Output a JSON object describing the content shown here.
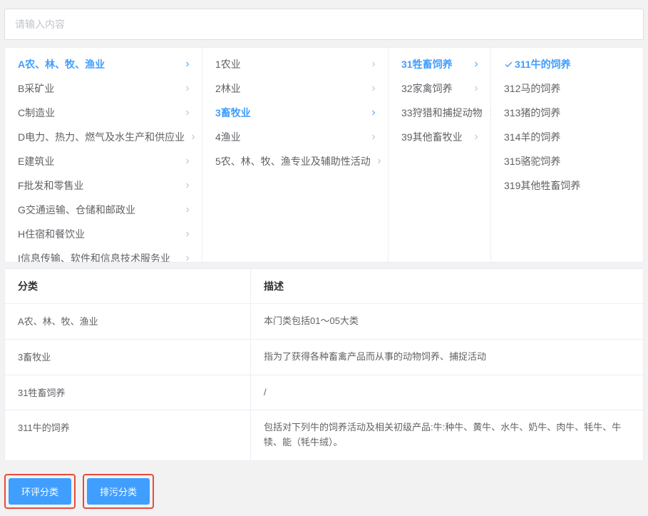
{
  "search": {
    "placeholder": "请输入内容"
  },
  "columns": [
    {
      "width_class": "col-0",
      "items": [
        {
          "label": "A农、林、牧、渔业",
          "has_children": true,
          "active": true
        },
        {
          "label": "B采矿业",
          "has_children": true
        },
        {
          "label": "C制造业",
          "has_children": true
        },
        {
          "label": "D电力、热力、燃气及水生产和供应业",
          "has_children": true
        },
        {
          "label": "E建筑业",
          "has_children": true
        },
        {
          "label": "F批发和零售业",
          "has_children": true
        },
        {
          "label": "G交通运输、仓储和邮政业",
          "has_children": true
        },
        {
          "label": "H住宿和餐饮业",
          "has_children": true
        },
        {
          "label": "I信息传输、软件和信息技术服务业",
          "has_children": true
        }
      ]
    },
    {
      "width_class": "col-1",
      "items": [
        {
          "label": "1农业",
          "has_children": true
        },
        {
          "label": "2林业",
          "has_children": true
        },
        {
          "label": "3畜牧业",
          "has_children": true,
          "active": true
        },
        {
          "label": "4渔业",
          "has_children": true
        },
        {
          "label": "5农、林、牧、渔专业及辅助性活动",
          "has_children": true
        }
      ]
    },
    {
      "width_class": "col-2",
      "items": [
        {
          "label": "31牲畜饲养",
          "has_children": true,
          "active": true
        },
        {
          "label": "32家禽饲养",
          "has_children": true
        },
        {
          "label": "33狩猎和捕捉动物",
          "has_children": true
        },
        {
          "label": "39其他畜牧业",
          "has_children": true
        }
      ]
    },
    {
      "width_class": "col-3",
      "items": [
        {
          "label": "311牛的饲养",
          "active": true,
          "checked": true
        },
        {
          "label": "312马的饲养"
        },
        {
          "label": "313猪的饲养"
        },
        {
          "label": "314羊的饲养"
        },
        {
          "label": "315骆驼饲养"
        },
        {
          "label": "319其他牲畜饲养"
        }
      ]
    }
  ],
  "desc": {
    "header_left": "分类",
    "header_right": "描述",
    "rows": [
      {
        "left": "A农、林、牧、渔业",
        "right": "本门类包括01～05大类"
      },
      {
        "left": "3畜牧业",
        "right": "指为了获得各种畜禽产品而从事的动物饲养、捕捉活动"
      },
      {
        "left": "31牲畜饲养",
        "right": "/"
      },
      {
        "left": "311牛的饲养",
        "right": "包括对下列牛的饲养活动及相关初级产品:牛:种牛、黄牛、水牛、奶牛、肉牛、牦牛、牛犊、能（牦牛绒）。"
      }
    ]
  },
  "buttons": {
    "env_eval": "环评分类",
    "pollution": "排污分类"
  }
}
